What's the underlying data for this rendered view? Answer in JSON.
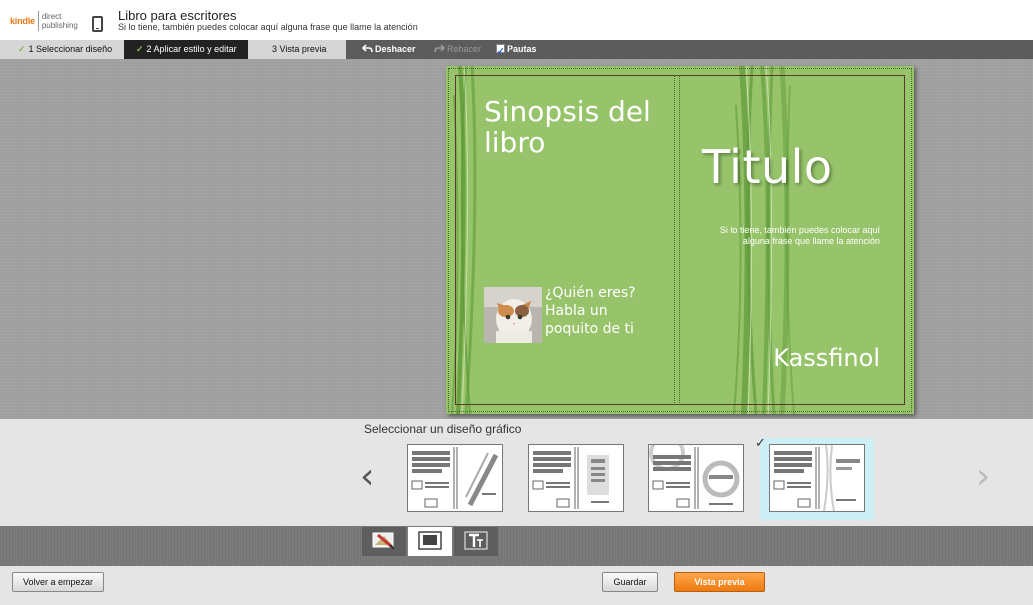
{
  "header": {
    "logo_kindle": "kindle",
    "logo_direct": "direct",
    "logo_publishing": "publishing",
    "book_title": "Libro para escritores",
    "book_subtitle": "Si lo tiene, también puedes colocar aquí alguna frase que llame la atención"
  },
  "steps": [
    {
      "label": "1 Seleccionar diseño",
      "done": true
    },
    {
      "label": "2 Aplicar estilo y editar",
      "done": true,
      "active": true
    },
    {
      "label": "3 Vista previa",
      "done": false
    }
  ],
  "toolbar": {
    "undo_label": "Deshacer",
    "redo_label": "Rehacer",
    "guides_label": "Pautas",
    "guides_checked": true
  },
  "cover": {
    "back_heading": "Sinopsis del libro",
    "author_blurb": "¿Quién eres? Habla un poquito de ti",
    "title": "Titulo",
    "subtitle": "Si lo tiene, también puedes colocar aquí alguna frase que llame la atención",
    "author": "Kassfinol",
    "background_color": "#97c46a"
  },
  "selector": {
    "title": "Seleccionar un diseño gráfico",
    "selected_index": 3,
    "layouts": [
      "layout-diagonal",
      "layout-image-column",
      "layout-circle",
      "layout-text-blocks"
    ]
  },
  "tabs": [
    {
      "name": "background-style-icon"
    },
    {
      "name": "layout-icon",
      "active": true
    },
    {
      "name": "text-style-icon"
    }
  ],
  "footer": {
    "restart_label": "Volver a empezar",
    "save_label": "Guardar",
    "preview_label": "Vista previa"
  }
}
